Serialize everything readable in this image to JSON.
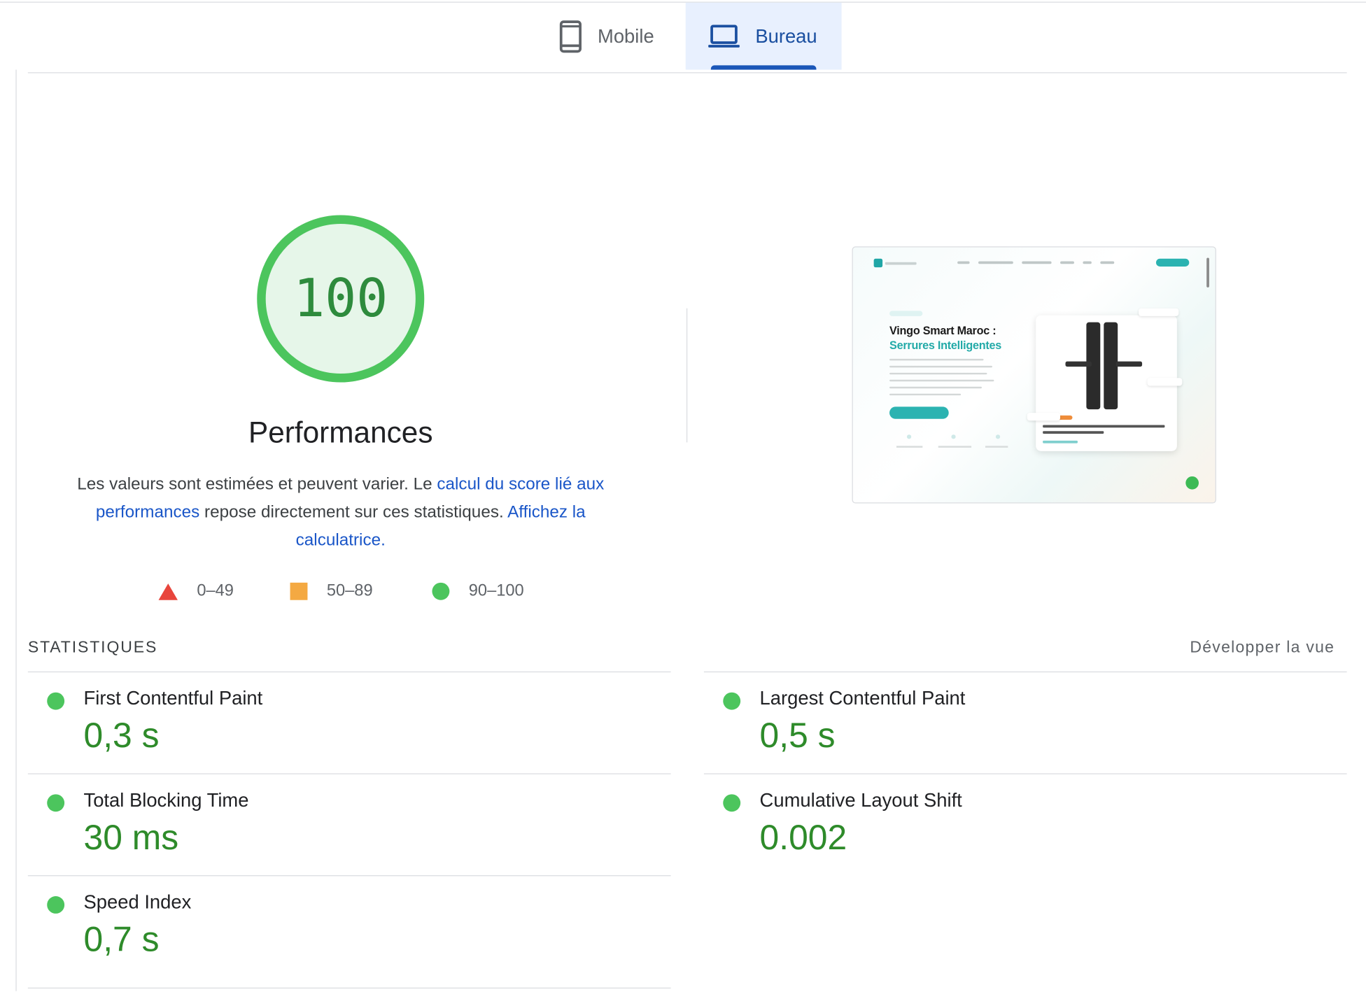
{
  "tabs": {
    "mobile_label": "Mobile",
    "desktop_label": "Bureau",
    "active": "Bureau"
  },
  "gauge": {
    "score": "100",
    "score_value": 100,
    "title": "Performances",
    "desc_part1": "Les valeurs sont estimées et peuvent varier. Le ",
    "desc_link1": "calcul du score lié aux performances",
    "desc_part2": " repose directement sur ces statistiques. ",
    "desc_link2": "Affichez la calculatrice."
  },
  "legend": {
    "fail": "0–49",
    "average": "50–89",
    "pass": "90–100"
  },
  "thumbnail": {
    "headline_line1": "Vingo Smart Maroc :",
    "headline_line2": "Serrures Intelligentes"
  },
  "statistics": {
    "title": "STATISTIQUES",
    "expand_label": "Développer la vue",
    "metrics": [
      {
        "name": "First Contentful Paint",
        "value": "0,3 s"
      },
      {
        "name": "Largest Contentful Paint",
        "value": "0,5 s"
      },
      {
        "name": "Total Blocking Time",
        "value": "30 ms"
      },
      {
        "name": "Cumulative Layout Shift",
        "value": "0.002"
      },
      {
        "name": "Speed Index",
        "value": "0,7 s"
      }
    ]
  },
  "colors": {
    "pass": "#4cc55d",
    "pass_text": "#2e8b2a",
    "average": "#f4a942",
    "fail": "#e8453c",
    "link": "#1a56c8",
    "active_tab_bg": "#e8f0fe"
  }
}
